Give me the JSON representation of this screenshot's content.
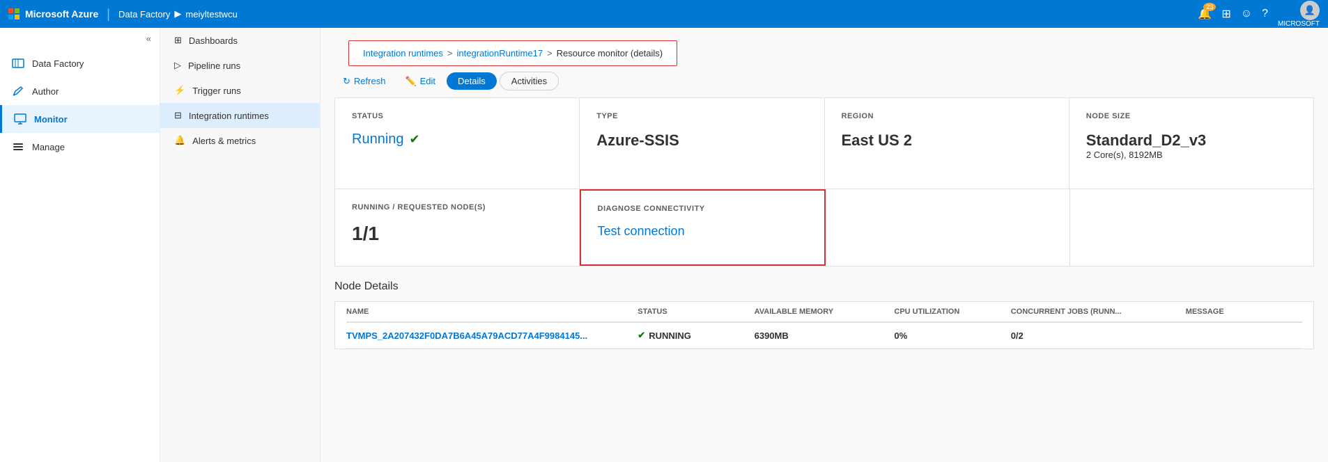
{
  "topbar": {
    "brand": "Microsoft Azure",
    "separator": "|",
    "nav1": "Data Factory",
    "nav2": "meiyltestwcu",
    "notification_count": "23",
    "icons": {
      "notifications": "🔔",
      "portal": "⊞",
      "feedback": "☺",
      "help": "?"
    },
    "user_label": "MICROSOFT"
  },
  "breadcrumb": {
    "link1": "Integration runtimes",
    "sep1": ">",
    "link2": "integrationRuntime17",
    "sep2": ">",
    "current": "Resource monitor (details)"
  },
  "toolbar": {
    "refresh_label": "Refresh",
    "edit_label": "Edit",
    "details_tab": "Details",
    "activities_tab": "Activities"
  },
  "sidebar": {
    "collapse_icon": "«",
    "items": [
      {
        "label": "Data Factory",
        "icon": "🏠",
        "active": false
      },
      {
        "label": "Author",
        "icon": "✏️",
        "active": false
      },
      {
        "label": "Monitor",
        "icon": "🖥️",
        "active": true
      },
      {
        "label": "Manage",
        "icon": "🧰",
        "active": false
      }
    ]
  },
  "subnav": {
    "items": [
      {
        "label": "Dashboards",
        "icon": "⊞",
        "active": false
      },
      {
        "label": "Pipeline runs",
        "icon": "▷",
        "active": false
      },
      {
        "label": "Trigger runs",
        "icon": "⚡",
        "active": false
      },
      {
        "label": "Integration runtimes",
        "icon": "⊟",
        "active": true
      },
      {
        "label": "Alerts & metrics",
        "icon": "🔔",
        "active": false
      }
    ]
  },
  "cards": {
    "status": {
      "label": "STATUS",
      "value": "Running",
      "check": "✔"
    },
    "type": {
      "label": "TYPE",
      "value": "Azure-SSIS"
    },
    "region": {
      "label": "REGION",
      "value": "East US 2"
    },
    "node_size": {
      "label": "NODE SIZE",
      "line1": "Standard_D2_v3",
      "line2": "2 Core(s), 8192MB"
    }
  },
  "cards2": {
    "nodes": {
      "label": "RUNNING / REQUESTED NODE(S)",
      "value": "1/1"
    },
    "diagnose": {
      "label": "DIAGNOSE CONNECTIVITY",
      "link": "Test connection"
    },
    "empty1": {},
    "empty2": {}
  },
  "node_details": {
    "title": "Node Details",
    "columns": {
      "name": "NAME",
      "status": "STATUS",
      "memory": "AVAILABLE MEMORY",
      "cpu": "CPU UTILIZATION",
      "jobs": "CONCURRENT JOBS (RUNN...",
      "message": "MESSAGE"
    },
    "rows": [
      {
        "name": "tvmps_2a207432f0da7b6a45a79acd77a4f9984145...",
        "status": "Running",
        "memory": "6390MB",
        "cpu": "0%",
        "jobs": "0/2",
        "message": ""
      }
    ]
  }
}
